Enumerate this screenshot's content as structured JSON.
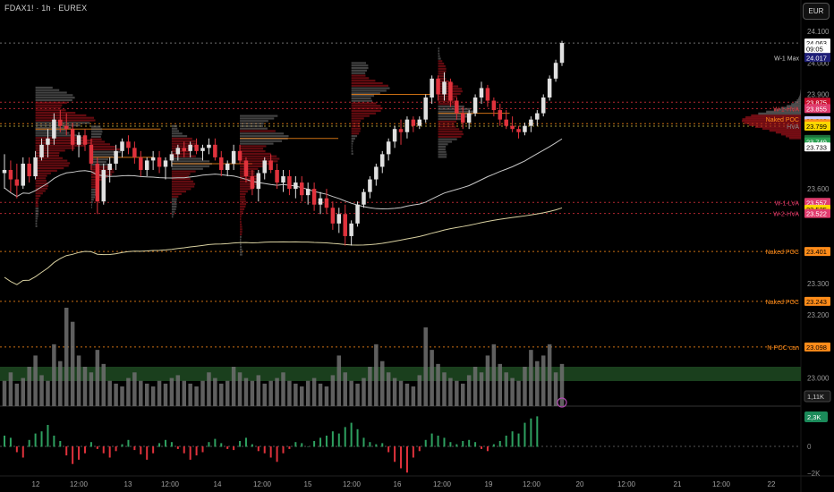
{
  "header": {
    "title": "FDAX1! · 1h · EUREX",
    "currency": "EUR"
  },
  "colors": {
    "up": "#e0e0e0",
    "down": "#e0323c",
    "profileGray": "#787878",
    "profileRed": "#b4141e",
    "ma200": "#d8d0a0",
    "ma50": "#c8c8c8",
    "levelOrange": "#ff8c1a",
    "levelRed": "#e0323c",
    "levelYellow": "#d4c040",
    "volume": "#707070"
  },
  "chart_data": {
    "type": "candlestick",
    "y_axis": {
      "min": 22950,
      "max": 24120,
      "ticks": [
        24100,
        24000,
        23900,
        23600,
        23300,
        23200,
        23000
      ]
    },
    "x_labels": [
      "12",
      "12:00",
      "13",
      "12:00",
      "14",
      "12:00",
      "15",
      "12:00",
      "16",
      "12:00",
      "19",
      "12:00",
      "20",
      "12:00",
      "21",
      "12:00",
      "22"
    ],
    "price_tags": [
      {
        "text": "24.063",
        "value": 24063,
        "bg": "#ffffff",
        "fg": "#000000"
      },
      {
        "text": "09:05",
        "value": 24045,
        "bg": "#ffffff",
        "fg": "#000000"
      },
      {
        "text": "24.017",
        "value": 24017,
        "bg": "#1e1e78",
        "fg": "#ffffff"
      },
      {
        "text": "23.875",
        "value": 23875,
        "bg": "#c8102e",
        "fg": "#ffffff"
      },
      {
        "text": "23.855",
        "value": 23855,
        "bg": "#e03c6e",
        "fg": "#ffffff"
      },
      {
        "text": "23.816",
        "value": 23816,
        "bg": "#c8c8ff",
        "fg": "#000000"
      },
      {
        "text": "23.807",
        "value": 23807,
        "bg": "#ff8c1a",
        "fg": "#000000"
      },
      {
        "text": "23.799",
        "value": 23799,
        "bg": "#ffd700",
        "fg": "#000000"
      },
      {
        "text": "23.757",
        "value": 23757,
        "bg": "#1e6e3c",
        "fg": "#ffffff"
      },
      {
        "text": "23.749",
        "value": 23749,
        "bg": "#28a050",
        "fg": "#ffffff"
      },
      {
        "text": "23.733",
        "value": 23733,
        "bg": "#ffffff",
        "fg": "#000000"
      },
      {
        "text": "23.557",
        "value": 23557,
        "bg": "#e03c6e",
        "fg": "#ffffff"
      },
      {
        "text": "23.535",
        "value": 23535,
        "bg": "#ffd700",
        "fg": "#000000"
      },
      {
        "text": "23.522",
        "value": 23522,
        "bg": "#e03c6e",
        "fg": "#ffffff"
      },
      {
        "text": "23.401",
        "value": 23401,
        "bg": "#ff8c1a",
        "fg": "#000000"
      },
      {
        "text": "23.243",
        "value": 23243,
        "bg": "#ff8c1a",
        "fg": "#000000"
      },
      {
        "text": "23.098",
        "value": 23098,
        "bg": "#ff8c1a",
        "fg": "#000000"
      }
    ],
    "level_labels": [
      {
        "text": "W-1 Max",
        "value": 24017,
        "color": "#cccccc"
      },
      {
        "text": "W-1-HVA",
        "value": 23855,
        "color": "#e0323c"
      },
      {
        "text": "Naked POC",
        "value": 23822,
        "color": "#ff8c1a"
      },
      {
        "text": "HVA",
        "value": 23799,
        "color": "#888888"
      },
      {
        "text": "W-1-LVA",
        "value": 23557,
        "color": "#e03c6e"
      },
      {
        "text": "W-2-HVA",
        "value": 23522,
        "color": "#e03c6e"
      },
      {
        "text": "Naked POC",
        "value": 23401,
        "color": "#ff8c1a"
      },
      {
        "text": "Naked POC",
        "value": 23243,
        "color": "#ff8c1a"
      },
      {
        "text": "N-POC can",
        "value": 23098,
        "color": "#ff8c1a"
      }
    ],
    "volume_tag": "1,11K",
    "indicator": {
      "ticks": [
        "0",
        "−2K"
      ],
      "tag": "2,3K"
    },
    "candles": [
      [
        23650,
        23710,
        23600,
        23660
      ],
      [
        23660,
        23690,
        23590,
        23630
      ],
      [
        23630,
        23680,
        23570,
        23610
      ],
      [
        23610,
        23700,
        23600,
        23680
      ],
      [
        23680,
        23700,
        23620,
        23640
      ],
      [
        23640,
        23720,
        23630,
        23700
      ],
      [
        23700,
        23760,
        23690,
        23740
      ],
      [
        23740,
        23790,
        23700,
        23760
      ],
      [
        23760,
        23840,
        23740,
        23820
      ],
      [
        23820,
        23850,
        23780,
        23800
      ],
      [
        23800,
        23840,
        23770,
        23790
      ],
      [
        23790,
        23810,
        23720,
        23740
      ],
      [
        23740,
        23780,
        23700,
        23770
      ],
      [
        23770,
        23790,
        23720,
        23740
      ],
      [
        23740,
        23760,
        23660,
        23680
      ],
      [
        23680,
        23700,
        23520,
        23560
      ],
      [
        23560,
        23680,
        23550,
        23660
      ],
      [
        23660,
        23700,
        23620,
        23680
      ],
      [
        23680,
        23740,
        23660,
        23720
      ],
      [
        23720,
        23760,
        23700,
        23750
      ],
      [
        23750,
        23770,
        23710,
        23730
      ],
      [
        23730,
        23750,
        23680,
        23700
      ],
      [
        23700,
        23720,
        23640,
        23660
      ],
      [
        23660,
        23700,
        23640,
        23690
      ],
      [
        23690,
        23720,
        23660,
        23700
      ],
      [
        23700,
        23720,
        23650,
        23670
      ],
      [
        23670,
        23700,
        23630,
        23690
      ],
      [
        23690,
        23720,
        23670,
        23710
      ],
      [
        23710,
        23740,
        23690,
        23730
      ],
      [
        23730,
        23750,
        23700,
        23720
      ],
      [
        23720,
        23750,
        23700,
        23740
      ],
      [
        23740,
        23760,
        23710,
        23720
      ],
      [
        23720,
        23740,
        23690,
        23730
      ],
      [
        23730,
        23760,
        23710,
        23740
      ],
      [
        23740,
        23760,
        23690,
        23700
      ],
      [
        23700,
        23720,
        23640,
        23660
      ],
      [
        23660,
        23690,
        23640,
        23680
      ],
      [
        23680,
        23740,
        23660,
        23720
      ],
      [
        23720,
        23740,
        23680,
        23690
      ],
      [
        23690,
        23700,
        23620,
        23640
      ],
      [
        23640,
        23660,
        23580,
        23600
      ],
      [
        23600,
        23660,
        23560,
        23650
      ],
      [
        23650,
        23700,
        23630,
        23690
      ],
      [
        23690,
        23710,
        23650,
        23660
      ],
      [
        23660,
        23680,
        23600,
        23620
      ],
      [
        23620,
        23660,
        23590,
        23640
      ],
      [
        23640,
        23660,
        23580,
        23600
      ],
      [
        23600,
        23640,
        23570,
        23620
      ],
      [
        23620,
        23640,
        23560,
        23580
      ],
      [
        23580,
        23620,
        23550,
        23600
      ],
      [
        23600,
        23620,
        23530,
        23550
      ],
      [
        23550,
        23590,
        23520,
        23570
      ],
      [
        23570,
        23600,
        23520,
        23540
      ],
      [
        23540,
        23560,
        23470,
        23490
      ],
      [
        23490,
        23540,
        23460,
        23520
      ],
      [
        23520,
        23550,
        23420,
        23450
      ],
      [
        23450,
        23500,
        23420,
        23490
      ],
      [
        23490,
        23560,
        23480,
        23550
      ],
      [
        23550,
        23600,
        23540,
        23590
      ],
      [
        23590,
        23640,
        23570,
        23630
      ],
      [
        23630,
        23680,
        23610,
        23670
      ],
      [
        23670,
        23720,
        23650,
        23710
      ],
      [
        23710,
        23760,
        23690,
        23750
      ],
      [
        23750,
        23800,
        23730,
        23790
      ],
      [
        23790,
        23820,
        23740,
        23780
      ],
      [
        23780,
        23830,
        23760,
        23820
      ],
      [
        23820,
        23830,
        23780,
        23800
      ],
      [
        23800,
        23830,
        23790,
        23820
      ],
      [
        23820,
        23900,
        23810,
        23890
      ],
      [
        23890,
        23960,
        23870,
        23950
      ],
      [
        23950,
        23960,
        23880,
        23900
      ],
      [
        23900,
        23970,
        23880,
        23940
      ],
      [
        23940,
        23950,
        23860,
        23880
      ],
      [
        23880,
        23890,
        23820,
        23840
      ],
      [
        23840,
        23860,
        23790,
        23810
      ],
      [
        23810,
        23850,
        23790,
        23840
      ],
      [
        23840,
        23900,
        23830,
        23890
      ],
      [
        23890,
        23940,
        23870,
        23920
      ],
      [
        23920,
        23930,
        23860,
        23880
      ],
      [
        23880,
        23890,
        23830,
        23850
      ],
      [
        23850,
        23870,
        23800,
        23820
      ],
      [
        23820,
        23850,
        23790,
        23800
      ],
      [
        23800,
        23830,
        23780,
        23790
      ],
      [
        23790,
        23800,
        23760,
        23780
      ],
      [
        23780,
        23810,
        23770,
        23800
      ],
      [
        23800,
        23830,
        23780,
        23820
      ],
      [
        23820,
        23850,
        23800,
        23840
      ],
      [
        23840,
        23900,
        23830,
        23890
      ],
      [
        23890,
        23960,
        23880,
        23950
      ],
      [
        23950,
        24010,
        23940,
        24000
      ],
      [
        24000,
        24070,
        23990,
        24063
      ]
    ],
    "volumes": [
      9,
      12,
      8,
      10,
      14,
      18,
      11,
      9,
      22,
      16,
      35,
      30,
      18,
      14,
      12,
      20,
      15,
      9,
      8,
      7,
      10,
      12,
      9,
      8,
      7,
      9,
      8,
      10,
      11,
      9,
      8,
      7,
      9,
      12,
      10,
      8,
      9,
      14,
      12,
      10,
      9,
      11,
      8,
      9,
      10,
      12,
      9,
      8,
      7,
      9,
      10,
      8,
      7,
      11,
      18,
      12,
      9,
      8,
      10,
      14,
      22,
      16,
      12,
      10,
      9,
      8,
      7,
      11,
      28,
      20,
      15,
      12,
      10,
      9,
      8,
      11,
      14,
      12,
      18,
      22,
      15,
      12,
      10,
      9,
      14,
      20,
      16,
      18,
      22,
      12,
      15
    ],
    "oscillator": [
      10,
      8,
      -5,
      -10,
      6,
      12,
      14,
      20,
      10,
      5,
      -8,
      -16,
      -12,
      -6,
      4,
      -2,
      -6,
      -10,
      -4,
      2,
      6,
      -3,
      -7,
      -12,
      -6,
      3,
      6,
      4,
      -2,
      -6,
      -12,
      -8,
      -5,
      4,
      7,
      3,
      -2,
      -3,
      5,
      8,
      2,
      -4,
      -6,
      -10,
      -14,
      -6,
      -2,
      4,
      3,
      0,
      5,
      8,
      10,
      14,
      12,
      18,
      22,
      16,
      8,
      4,
      2,
      3,
      -5,
      -14,
      -20,
      -24,
      -10,
      -4,
      6,
      12,
      10,
      8,
      4,
      2,
      5,
      6,
      4,
      -2,
      -4,
      2,
      5,
      10,
      14,
      12,
      22,
      26,
      28
    ]
  }
}
